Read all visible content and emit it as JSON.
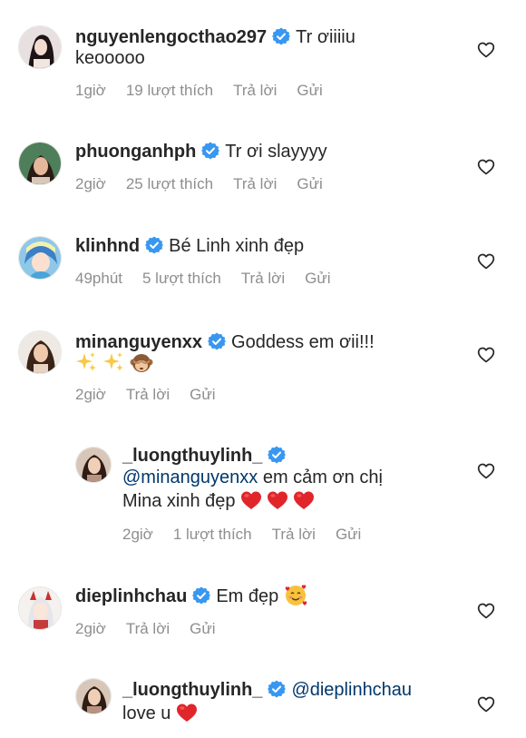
{
  "comments": [
    {
      "username": "nguyenlengocthao297",
      "text_line1": "Tr ơiiiiu",
      "text_line2": "keooooo",
      "time": "1giờ",
      "likes": "19 lượt thích",
      "reply": "Trả lời",
      "send": "Gửi"
    },
    {
      "username": "phuonganhph",
      "text": "Tr ơi slayyyy",
      "time": "2giờ",
      "likes": "25 lượt thích",
      "reply": "Trả lời",
      "send": "Gửi"
    },
    {
      "username": "klinhnd",
      "text": "Bé Linh xinh đẹp",
      "time": "49phút",
      "likes": "5 lượt thích",
      "reply": "Trả lời",
      "send": "Gửi"
    },
    {
      "username": "minanguyenxx",
      "text": "Goddess em ơii!!!",
      "time": "2giờ",
      "reply": "Trả lời",
      "send": "Gửi"
    },
    {
      "username": "_luongthuylinh_",
      "mention": "@minanguyenxx",
      "text_line1": "em cảm ơn chị",
      "text_line2": "Mina xinh đẹp",
      "time": "2giờ",
      "likes": "1 lượt thích",
      "reply": "Trả lời",
      "send": "Gửi"
    },
    {
      "username": "dieplinhchau",
      "text": "Em đẹp",
      "time": "2giờ",
      "reply": "Trả lời",
      "send": "Gửi"
    },
    {
      "username": "_luongthuylinh_",
      "mention": "@dieplinhchau",
      "text_line2": "love u"
    }
  ],
  "colors": {
    "username": "#262626",
    "meta": "#8e8e8e",
    "mention": "#00376b",
    "verified": "#3897f0",
    "heart_red": "#e0262b"
  },
  "icons": [
    "verified-badge-icon",
    "heart-outline-icon",
    "red-heart-emoji",
    "sparkles-emoji",
    "see-no-evil-monkey-emoji",
    "smiling-face-with-hearts-emoji"
  ]
}
